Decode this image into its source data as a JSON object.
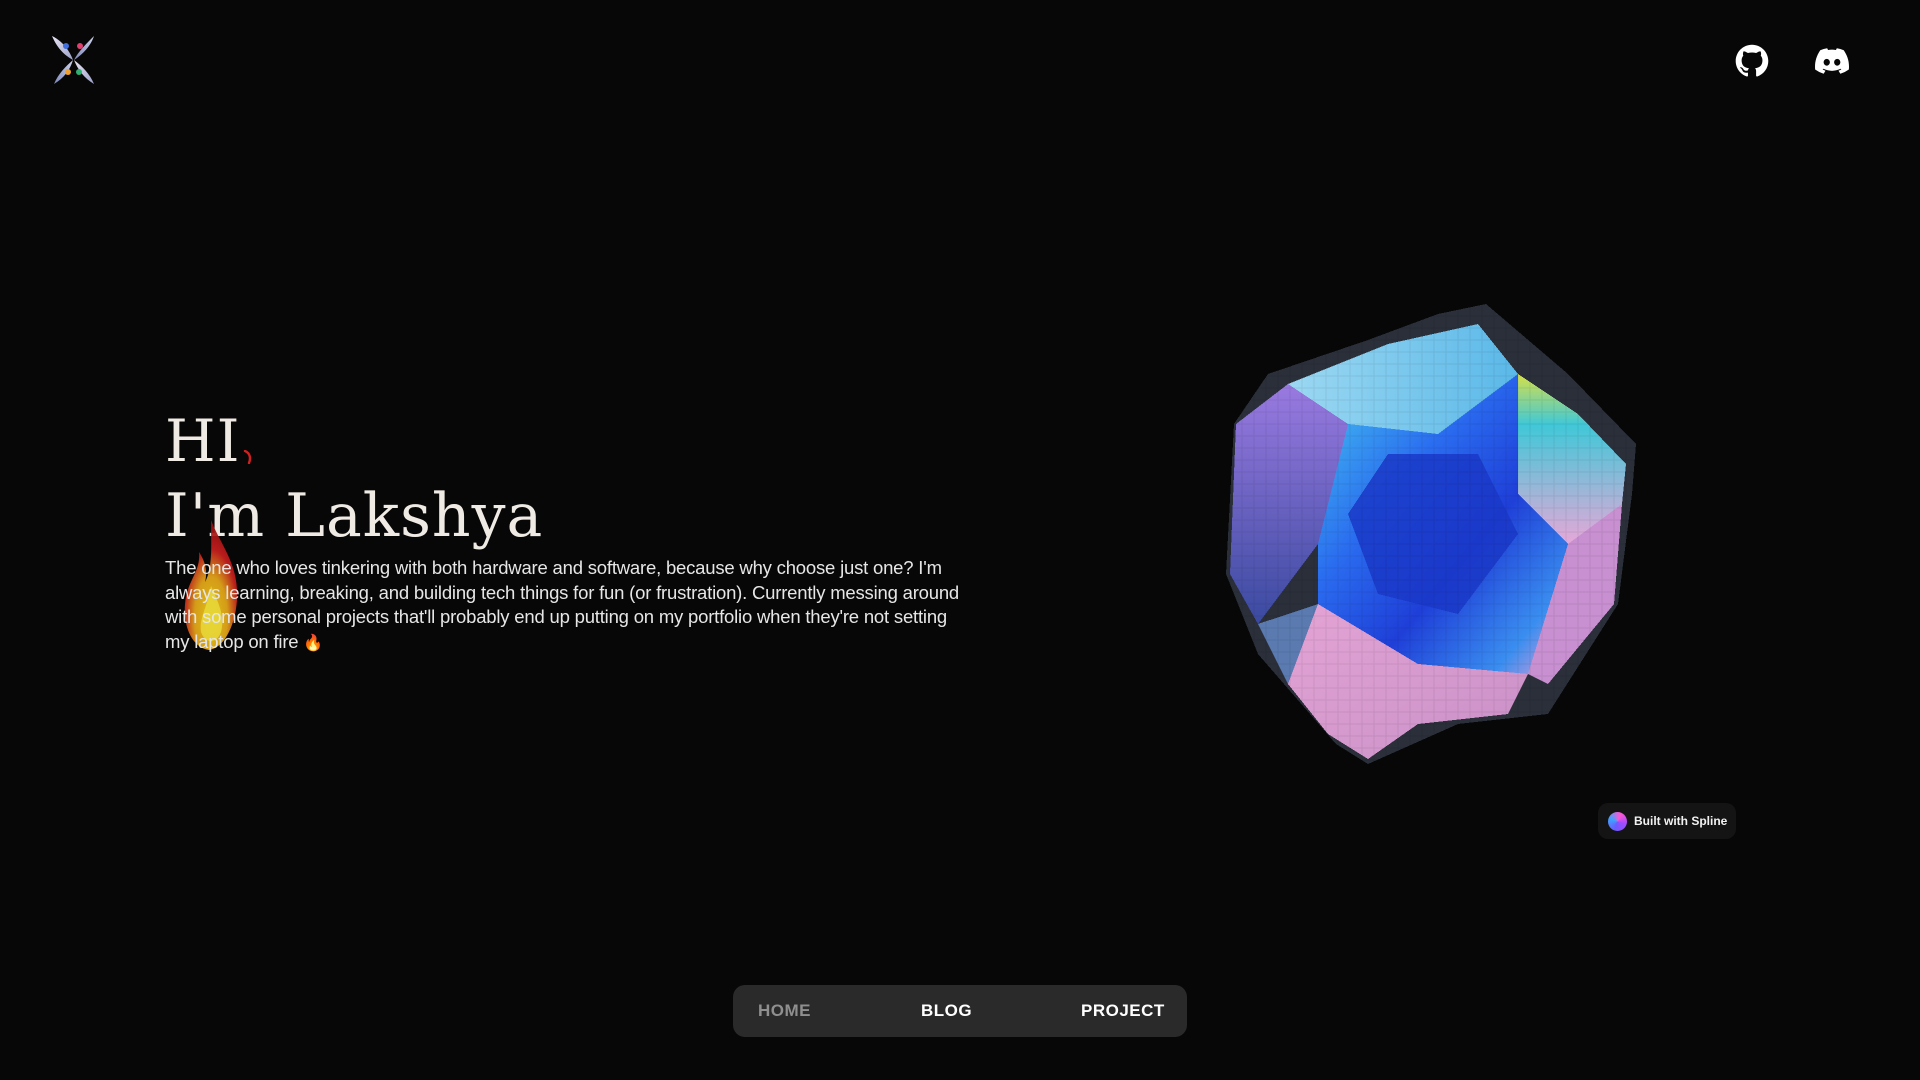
{
  "header": {
    "logo_icon": "butterfly-x-logo-icon",
    "social": [
      {
        "icon": "github-icon"
      },
      {
        "icon": "discord-icon"
      }
    ]
  },
  "hero": {
    "greeting": "HI",
    "name": "I'm Lakshya",
    "bio": "The one who loves tinkering with both hardware and software, because why choose just one? I'm always learning, breaking, and building tech things for fun (or frustration). Currently messing around with some personal projects that'll probably end up putting on my portfolio when they're not setting my laptop on fire",
    "bio_emoji": "🔥"
  },
  "spline": {
    "badge_label": "Built with Spline",
    "badge_icon": "spline-logo-icon"
  },
  "nav": {
    "items": [
      {
        "label": "HOME",
        "active": true
      },
      {
        "label": "BLOG"
      },
      {
        "label": "PROJECT"
      }
    ]
  },
  "colors": {
    "background": "#070707",
    "nav_background": "#2a2a2a",
    "nav_active_text": "#8f8f8f",
    "accent_red": "#d02020"
  }
}
